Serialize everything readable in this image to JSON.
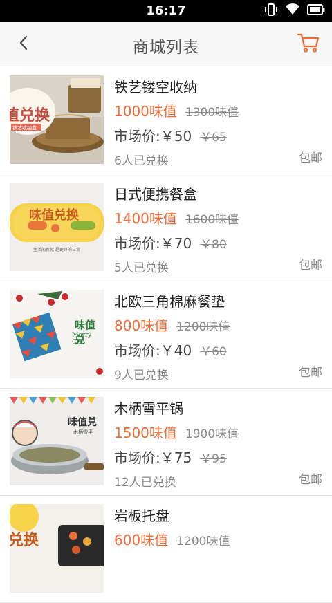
{
  "status_bar": {
    "time": "16:17"
  },
  "header": {
    "title": "商城列表",
    "back_icon": "back-arrow-icon",
    "cart_icon": "shopping-cart-icon"
  },
  "colors": {
    "accent": "#f26b36",
    "text": "#222222",
    "muted": "#8a8a8a"
  },
  "items": [
    {
      "name": "铁艺镂空收纳",
      "price": "1000味值",
      "orig_price": "1300味值",
      "market": "市场价:￥50",
      "market_orig": "￥65",
      "count": "6人已兑换",
      "shipping": "包邮",
      "image_text": "值兑换",
      "image_sub": "铁艺收纳盒"
    },
    {
      "name": "日式便携餐盒",
      "price": "1400味值",
      "orig_price": "1600味值",
      "market": "市场价:￥70",
      "market_orig": "￥80",
      "count": "5人已兑换",
      "shipping": "包邮",
      "image_text": "味值兑换",
      "image_sub": "生活的新就 是更好的日常"
    },
    {
      "name": "北欧三角棉麻餐垫",
      "price": "800味值",
      "orig_price": "1200味值",
      "market": "市场价:￥40",
      "market_orig": "￥60",
      "count": "9人已兑换",
      "shipping": "包邮",
      "image_text": "味值兑",
      "image_sub": "Merry Chr"
    },
    {
      "name": "木柄雪平锅",
      "price": "1500味值",
      "orig_price": "1900味值",
      "market": "市场价:￥75",
      "market_orig": "￥95",
      "count": "12人已兑换",
      "shipping": "包邮",
      "image_text": "味值兑",
      "image_sub": "木柄雪平"
    },
    {
      "name": "岩板托盘",
      "price": "600味值",
      "orig_price": "1200味值",
      "market": "",
      "market_orig": "",
      "count": "",
      "shipping": "",
      "image_text": "兑换",
      "image_sub": ""
    }
  ]
}
